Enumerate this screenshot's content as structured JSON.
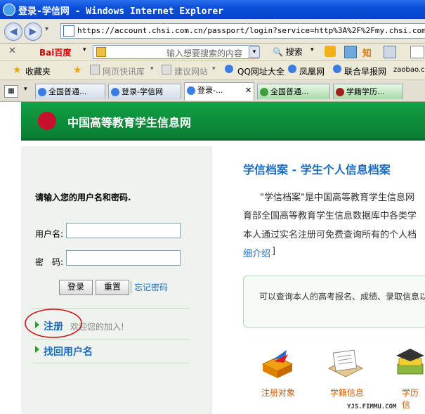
{
  "window": {
    "title": "登录-学信网 - Windows Internet Explorer"
  },
  "address": {
    "url": "https://account.chsi.com.cn/passport/login?service=http%3A%2F%2Fmy.chsi.com.cn%2Fa"
  },
  "toolbar": {
    "search_placeholder": "输入想要搜索的内容",
    "search_button": "搜索",
    "baidu": "Bai百度",
    "zhi": "知"
  },
  "favorites": {
    "label": "收藏夹",
    "items": [
      "网页快讯库",
      "建议网站",
      "QQ网址大全",
      "凤凰网",
      "联合早报网",
      "zaobao.c"
    ]
  },
  "tabs": [
    "全国普通...",
    "登录-学信网",
    "登录-...",
    "全国普通...",
    "学籍学历..."
  ],
  "header": {
    "site_name": "中国高等教育学生信息网"
  },
  "login": {
    "prompt": "请输入您的用户名和密码.",
    "username_label": "用户名:",
    "password_label": "密　码:",
    "login_button": "登录",
    "reset_button": "重置",
    "forgot_password": "忘记密码",
    "register_link": "注册",
    "register_note": "欢迎您的加入!",
    "recover_link": "找回用户名"
  },
  "content": {
    "title": "学信档案 - 学生个人信息档案",
    "para_line1": "\"学信档案\"是中国高等教育学生信息网",
    "para_line2": "育部全国高等教育学生信息数据库中各类学",
    "para_line3": "本人通过实名注册可免费查询所有的个人档",
    "para_line4_link": "细介绍",
    "para_line4_tail": "]",
    "note": "可以查询本人的高考报名、成绩、录取信息以"
  },
  "features": [
    {
      "label": "注册对象",
      "icon": "register-target-icon"
    },
    {
      "label": "学籍信息",
      "icon": "student-status-icon"
    },
    {
      "label": "学历信",
      "icon": "diploma-icon"
    }
  ],
  "watermark": "YJS.FIMMU.COM",
  "colors": {
    "header_green": "#0a7d33",
    "link_blue": "#1a6bbf",
    "title_blue": "#0545c8",
    "annotation_red": "#c81010"
  }
}
